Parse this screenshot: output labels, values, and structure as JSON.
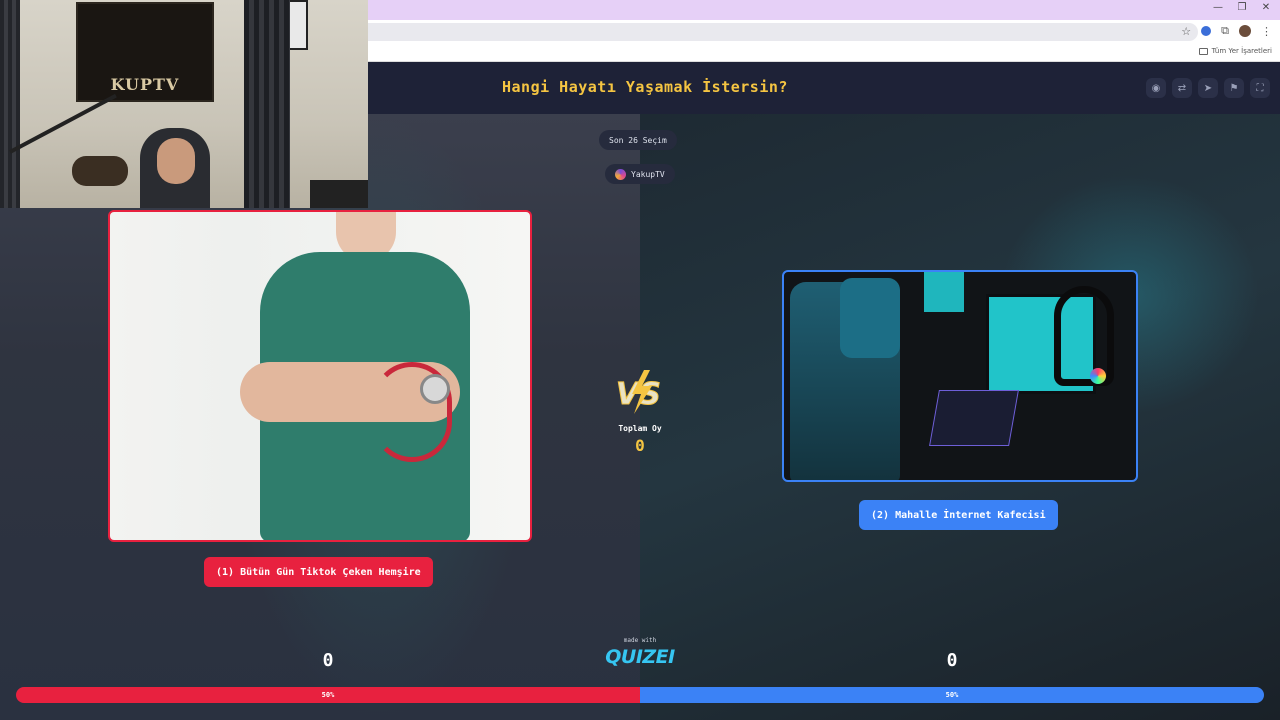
{
  "browser": {
    "bookmarks_label": "Tüm Yer İşaretleri",
    "window_controls": [
      "—",
      "❐",
      "✕"
    ]
  },
  "header": {
    "title": "Hangi Hayatı Yaşamak İstersin?",
    "actions": [
      "eye-icon",
      "share-icon",
      "send-icon",
      "flag-icon",
      "fullscreen-icon"
    ]
  },
  "webcam": {
    "poster_text": "KUPTV"
  },
  "center": {
    "choices_pill": "Son 26 Seçim",
    "streamer_name": "YakupTV",
    "total_label": "Toplam Oy",
    "total_value": "0"
  },
  "options": [
    {
      "label": "(1) Bütün Gün Tiktok Çeken Hemşire",
      "votes": "0",
      "percent": "50%",
      "color": "#e8213f"
    },
    {
      "label": "(2) Mahalle İnternet Kafecisi",
      "votes": "0",
      "percent": "50%",
      "color": "#3b82f6"
    }
  ],
  "footer": {
    "made_with": "made with",
    "brand": "QUIZEI"
  },
  "vote_split": {
    "left_fraction": 0.5,
    "right_fraction": 0.5
  },
  "colors": {
    "accent_title": "#f5c542",
    "header_bg": "#1e2237",
    "brand": "#36c6f2"
  }
}
